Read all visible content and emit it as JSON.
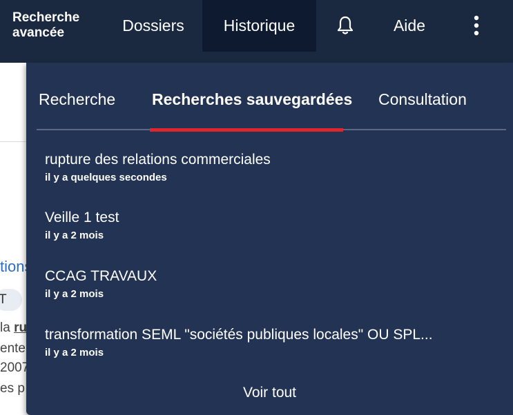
{
  "header": {
    "brand_line1": "Recherche",
    "brand_line2": "avancée",
    "nav": {
      "dossiers": "Dossiers",
      "historique": "Historique",
      "aide": "Aide"
    },
    "icons": {
      "notifications": "bell-icon",
      "more": "vertical-ellipsis-icon"
    }
  },
  "background_page": {
    "link_fragment": "tions",
    "tag_fragment": "T",
    "line1_prefix": "la ",
    "line1_bold": "ru",
    "line2": "ente",
    "line3": "2007",
    "line4": "es p"
  },
  "dropdown": {
    "tabs": [
      {
        "label": "Recherche"
      },
      {
        "label": "Recherches sauvegardées"
      },
      {
        "label": "Consultation"
      }
    ],
    "active_tab": "Recherches sauvegardées",
    "items": [
      {
        "title": "rupture des relations commerciales",
        "time": "il y a quelques secondes"
      },
      {
        "title": "Veille 1 test",
        "time": "il y a 2 mois"
      },
      {
        "title": "CCAG TRAVAUX",
        "time": "il y a 2 mois"
      },
      {
        "title": "transformation SEML \"sociétés publiques locales\" OU SPL...",
        "time": "il y a 2 mois"
      }
    ],
    "see_all": "Voir tout"
  },
  "colors": {
    "topbar": "#1b2940",
    "active_nav": "#0d1a2f",
    "panel": "#233354",
    "accent": "#e0262d",
    "link": "#2b6cc4"
  }
}
